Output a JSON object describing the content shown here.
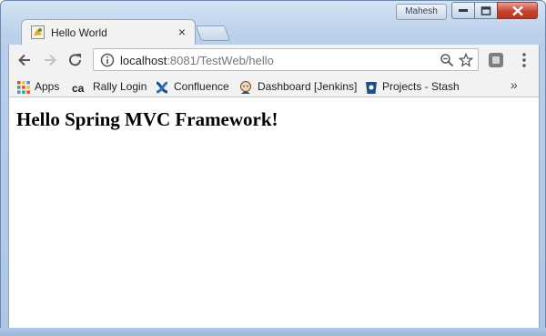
{
  "window": {
    "user_name": "Mahesh"
  },
  "tab": {
    "title": "Hello World",
    "close_glyph": "×"
  },
  "toolbar": {
    "url_host": "localhost",
    "url_rest": ":8081/TestWeb/hello"
  },
  "bookmarks": [
    {
      "label": "Apps",
      "icon": "apps-grid-icon"
    },
    {
      "label": "Rally Login",
      "icon": "rally-ca-icon"
    },
    {
      "label": "Confluence",
      "icon": "confluence-icon"
    },
    {
      "label": "Dashboard [Jenkins]",
      "icon": "jenkins-icon"
    },
    {
      "label": "Projects - Stash",
      "icon": "stash-icon"
    }
  ],
  "bookmarks_more": "»",
  "page": {
    "heading": "Hello Spring MVC Framework!"
  },
  "colors": {
    "window_frame": "#aec6e6",
    "close_button": "#c7432f"
  }
}
